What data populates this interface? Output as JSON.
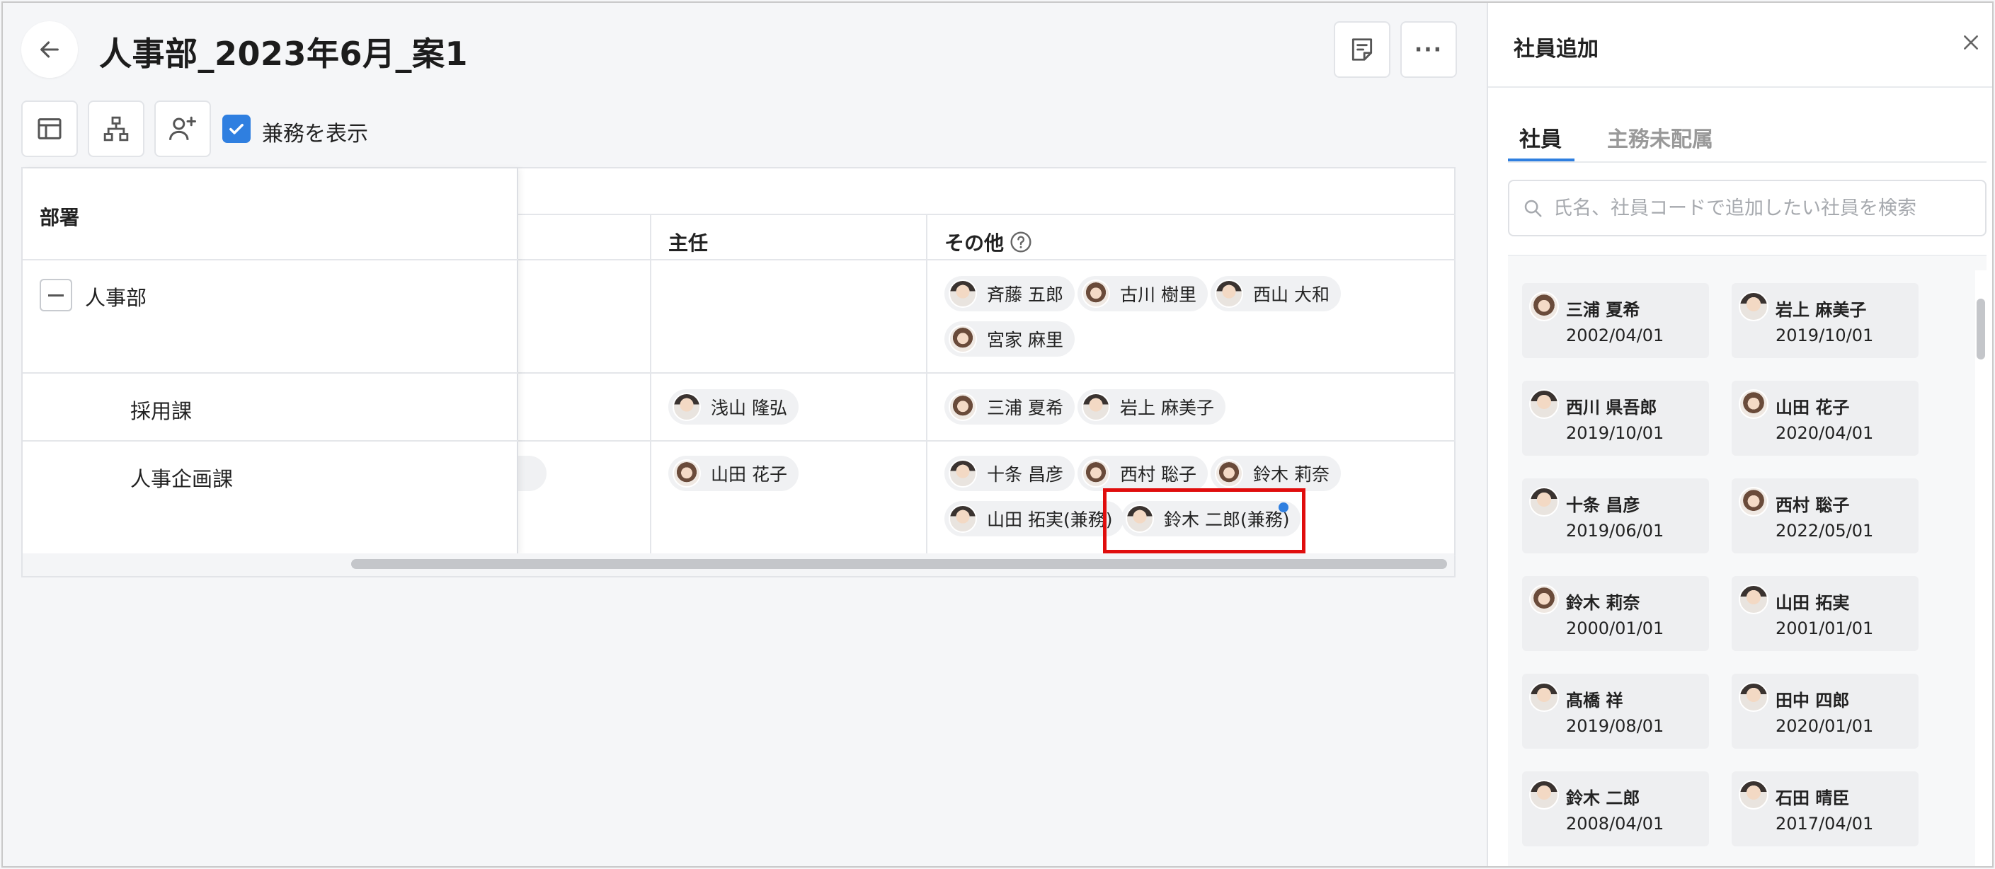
{
  "header": {
    "title": "人事部_2023年6月_案1",
    "show_concurrent_label": "兼務を表示",
    "more_label": "···"
  },
  "table": {
    "columns": {
      "dept": "部署",
      "chief": "主任",
      "other": "その他"
    },
    "rows": [
      {
        "dept": "人事部",
        "chief": "",
        "others": [
          "斉藤 五郎",
          "古川 樹里",
          "西山 大和",
          "宮家 麻里"
        ]
      },
      {
        "dept": "採用課",
        "chief": "浅山 隆弘",
        "others": [
          "三浦 夏希",
          "岩上 麻美子"
        ]
      },
      {
        "dept": "人事企画課",
        "chief": "山田 花子",
        "others": [
          "十条 昌彦",
          "西村 聡子",
          "鈴木 莉奈",
          "山田 拓実(兼務)",
          "鈴木 二郎(兼務)"
        ]
      }
    ]
  },
  "panel": {
    "title": "社員追加",
    "tabs": [
      "社員",
      "主務未配属"
    ],
    "active_tab": "社員",
    "search_placeholder": "氏名、社員コードで追加したい社員を検索",
    "employees": [
      {
        "name": "三浦 夏希",
        "date": "2002/04/01"
      },
      {
        "name": "岩上 麻美子",
        "date": "2019/10/01"
      },
      {
        "name": "西川 県吾郎",
        "date": "2019/10/01"
      },
      {
        "name": "山田 花子",
        "date": "2020/04/01"
      },
      {
        "name": "十条 昌彦",
        "date": "2019/06/01"
      },
      {
        "name": "西村 聡子",
        "date": "2022/05/01"
      },
      {
        "name": "鈴木 莉奈",
        "date": "2000/01/01"
      },
      {
        "name": "山田 拓実",
        "date": "2001/01/01"
      },
      {
        "name": "髙橋 祥",
        "date": "2019/08/01"
      },
      {
        "name": "田中 四郎",
        "date": "2020/01/01"
      },
      {
        "name": "鈴木 二郎",
        "date": "2008/04/01"
      },
      {
        "name": "石田 晴臣",
        "date": "2017/04/01"
      }
    ]
  },
  "colors": {
    "accent": "#2f7fe0",
    "highlight": "#e00d0d"
  }
}
